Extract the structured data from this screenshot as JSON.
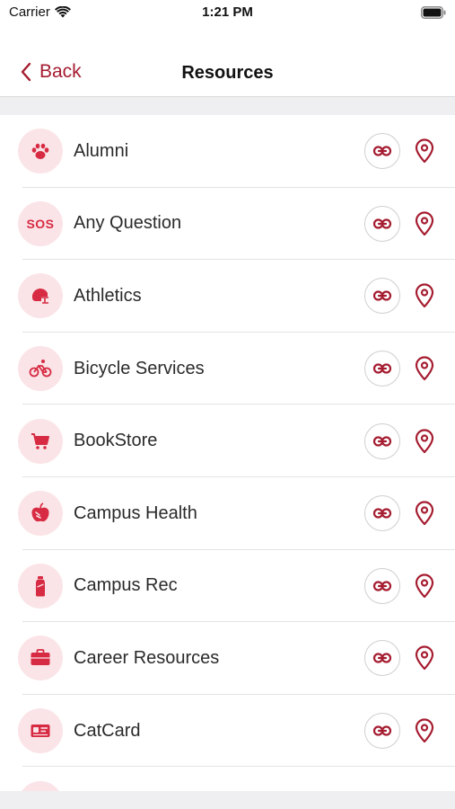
{
  "status_bar": {
    "carrier": "Carrier",
    "time": "1:21 PM"
  },
  "nav": {
    "back_label": "Back",
    "title": "Resources"
  },
  "colors": {
    "accent": "#a51c30",
    "icon_fill": "#d72b43",
    "icon_bg": "#fbe4e7"
  },
  "resources": [
    {
      "label": "Alumni",
      "icon": "paw-icon"
    },
    {
      "label": "Any Question",
      "icon": "sos-icon",
      "icon_text": "SOS"
    },
    {
      "label": "Athletics",
      "icon": "football-helmet-icon"
    },
    {
      "label": "Bicycle Services",
      "icon": "bicycle-icon"
    },
    {
      "label": "BookStore",
      "icon": "shopping-cart-icon"
    },
    {
      "label": "Campus Health",
      "icon": "apple-icon"
    },
    {
      "label": "Campus Rec",
      "icon": "water-bottle-icon"
    },
    {
      "label": "Career Resources",
      "icon": "briefcase-icon"
    },
    {
      "label": "CatCard",
      "icon": "id-card-icon"
    }
  ]
}
